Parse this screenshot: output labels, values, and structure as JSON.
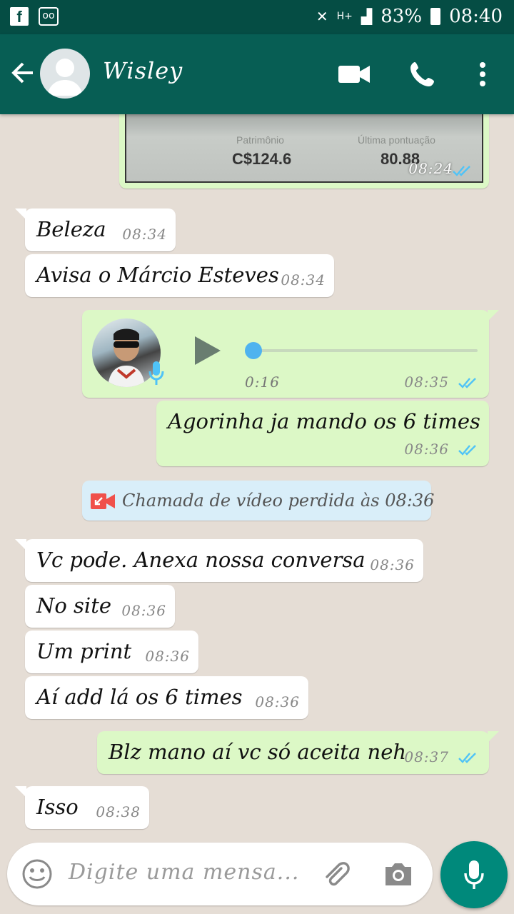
{
  "status_bar": {
    "battery": "83%",
    "time": "08:40",
    "network": "H+"
  },
  "header": {
    "contact_name": "Wisley"
  },
  "photo_message": {
    "label_1": "Patrimônio",
    "value_1": "C$124.6",
    "label_2": "Última pontuação",
    "value_2": "80.88",
    "time": "08:24"
  },
  "messages": [
    {
      "dir": "in",
      "text": "Beleza",
      "time": "08:34"
    },
    {
      "dir": "in",
      "text": "Avisa o Márcio Esteves",
      "time": "08:34"
    },
    {
      "dir": "out",
      "type": "voice",
      "duration": "0:16",
      "time": "08:35",
      "progress": 0.0
    },
    {
      "dir": "out",
      "text": "Agorinha ja mando os 6 times",
      "time": "08:36"
    },
    {
      "dir": "system",
      "text": "Chamada de vídeo perdida às 08:36"
    },
    {
      "dir": "in",
      "text": "Vc pode. Anexa nossa conversa",
      "time": "08:36"
    },
    {
      "dir": "in",
      "text": "No site",
      "time": "08:36"
    },
    {
      "dir": "in",
      "text": "Um print",
      "time": "08:36"
    },
    {
      "dir": "in",
      "text": "Aí add lá os 6 times",
      "time": "08:36"
    },
    {
      "dir": "out",
      "text": "Blz mano aí vc só aceita neh",
      "time": "08:37"
    },
    {
      "dir": "in",
      "text": "Isso",
      "time": "08:38"
    }
  ],
  "input": {
    "placeholder": "Digite uma mensa..."
  },
  "colors": {
    "header": "#075e54",
    "status": "#054d44",
    "outgoing": "#dcf8c6",
    "accent": "#00897b",
    "read_ticks": "#4fc3f7"
  },
  "icons": [
    "back-arrow-icon",
    "video-call-icon",
    "phone-icon",
    "more-icon",
    "play-icon",
    "mic-icon",
    "emoji-icon",
    "attach-icon",
    "camera-icon",
    "missed-video-icon",
    "double-check-icon"
  ]
}
